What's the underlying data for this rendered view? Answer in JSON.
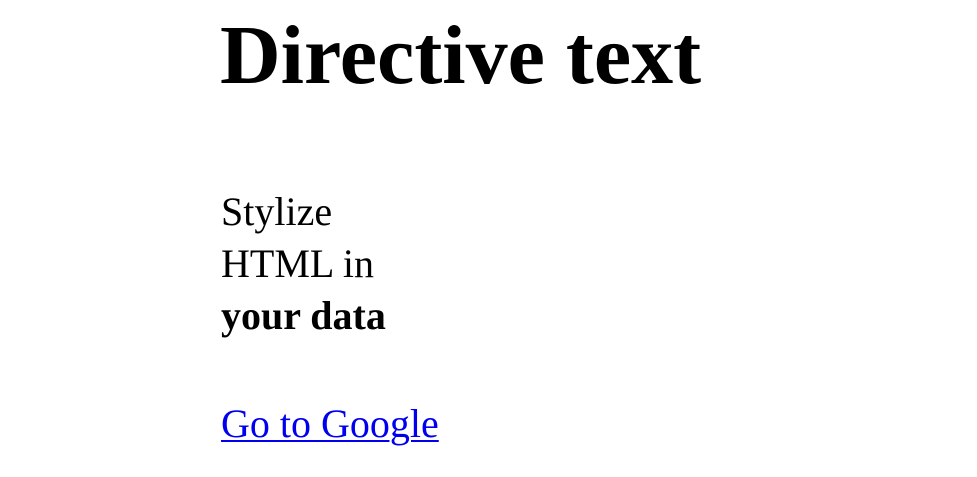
{
  "heading": "Directive text",
  "body": {
    "line1": "Stylize",
    "line2": "HTML in",
    "line3_bold": "your data"
  },
  "link": {
    "label": "Go to Google"
  },
  "colors": {
    "text": "#000000",
    "link": "#0000ee",
    "background": "#ffffff"
  }
}
